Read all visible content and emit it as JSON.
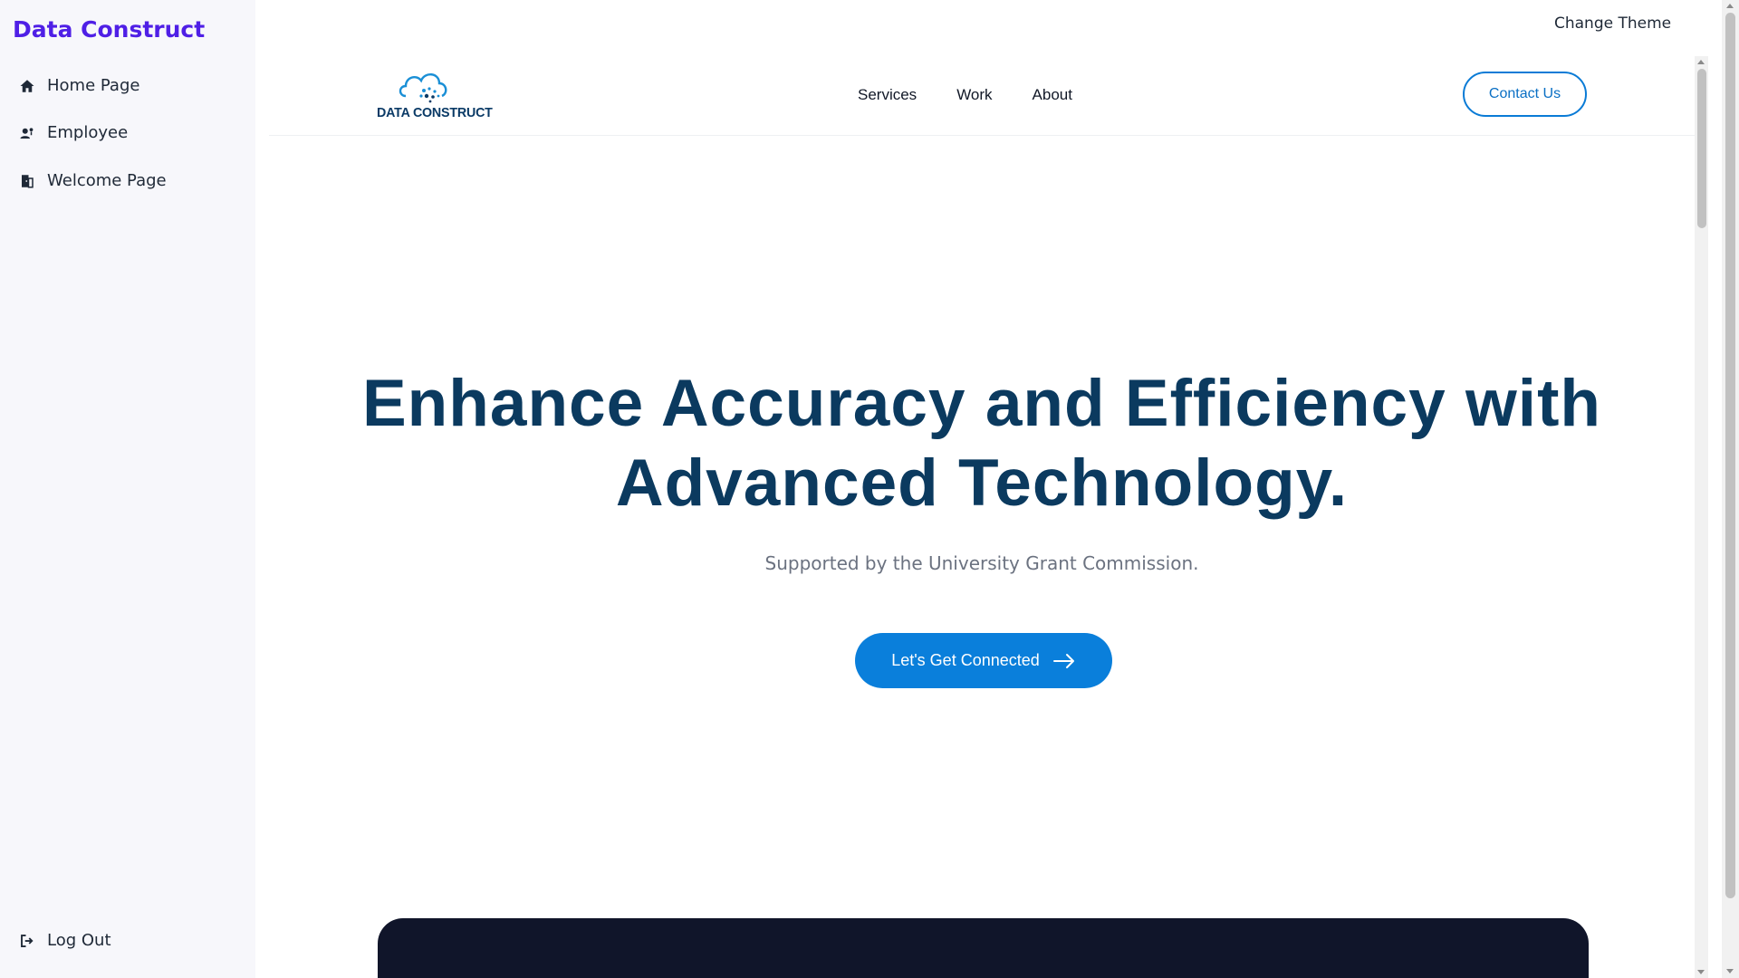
{
  "sidebar": {
    "brand": "Data Construct",
    "items": [
      {
        "label": "Home Page",
        "icon": "home-icon"
      },
      {
        "label": "Employee",
        "icon": "employee-icon"
      },
      {
        "label": "Welcome Page",
        "icon": "door-icon"
      }
    ],
    "logout": {
      "label": "Log Out",
      "icon": "logout-icon"
    }
  },
  "topbar": {
    "change_theme": "Change Theme"
  },
  "header": {
    "logo_text": "DATA CONSTRUCT",
    "logo_icon": "cloud-logo-icon",
    "nav": [
      "Services",
      "Work",
      "About"
    ],
    "contact_label": "Contact Us"
  },
  "hero": {
    "title_line1": "Enhance Accuracy and Efficiency with",
    "title_line2": "Advanced Technology.",
    "subtitle": "Supported by the University Grant Commission.",
    "cta_label": "Let's Get Connected",
    "cta_icon": "arrow-right-icon"
  },
  "colors": {
    "brand": "#4f1fe6",
    "primary": "#0a7fdb",
    "title": "#0b3a5f",
    "dark_panel": "#10152a"
  }
}
